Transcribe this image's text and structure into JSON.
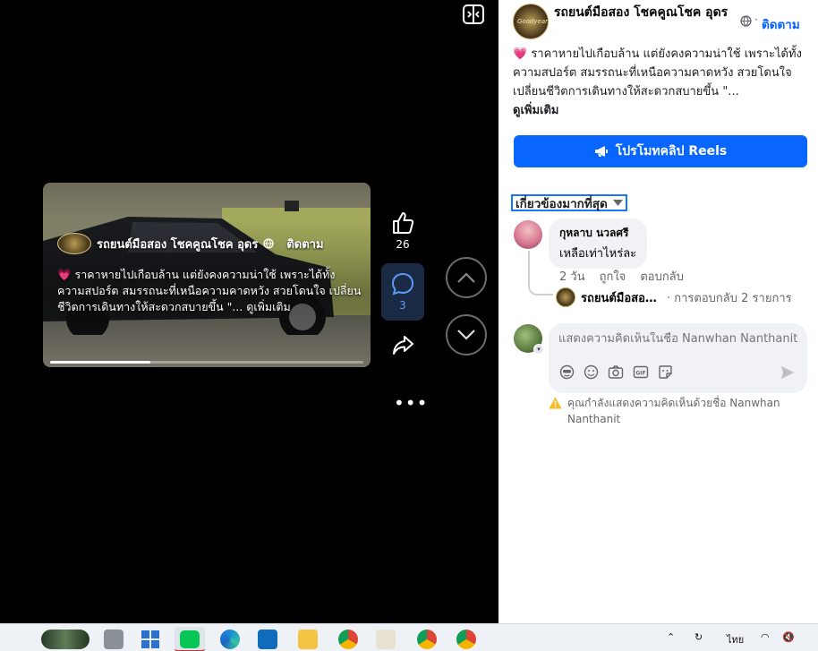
{
  "video": {
    "page_name": "รถยนต์มือสอง โชคคูณโชค อุดร",
    "follow_label": "ติดตาม",
    "caption": "💗 ราคาหายไปเกือบล้าน แต่ยังคงความน่าใช้ เพราะได้ทั้งความสปอร์ต สมรรถนะที่เหนือความคาดหวัง สวยโดนใจ เปลี่ยนชีวิตการเดินทางให้สะดวกสบายขึ้น \"... ดูเพิ่มเติม",
    "likes": "26",
    "comments": "3",
    "progress": 0.32,
    "logo_text": "Goodyear"
  },
  "panel": {
    "page_name": "รถยนต์มือสอง โชคคูณโชค อุดร",
    "logo_text": "Goodyear",
    "dot": "·",
    "follow_label": "ติดตาม",
    "description": "💗 ราคาหายไปเกือบล้าน แต่ยังคงความน่าใช้ เพราะได้ทั้งความสปอร์ต สมรรถนะที่เหนือความคาดหวัง สวยโดนใจ เปลี่ยนชีวิตการเดินทางให้สะดวกสบายขึ้น \"...",
    "see_more": "ดูเพิ่มเติม",
    "promote_label": "โปรโมทคลิป Reels",
    "sort_label": "เกี่ยวข้องมากที่สุด",
    "comment": {
      "author": "กุหลาบ นวลศรี",
      "text": "เหลือเท่าไหร่ละ",
      "time": "2 วัน",
      "like": "ถูกใจ",
      "reply": "ตอบกลับ",
      "reply_author": "รถยนต์มือสอง โชคคูณโชค อุดร",
      "reply_count": "· การตอบกลับ 2 รายการ"
    },
    "composer_placeholder": "แสดงความคิดเห็นในชื่อ Nanwhan Nanthanit",
    "warning": "คุณกำลังแสดงความคิดเห็นด้วยชื่อ Nanwhan Nanthanit"
  },
  "taskbar": {
    "lang": "ไทย"
  },
  "colors": {
    "accent": "#0866ff",
    "bg_dark": "#000000"
  }
}
